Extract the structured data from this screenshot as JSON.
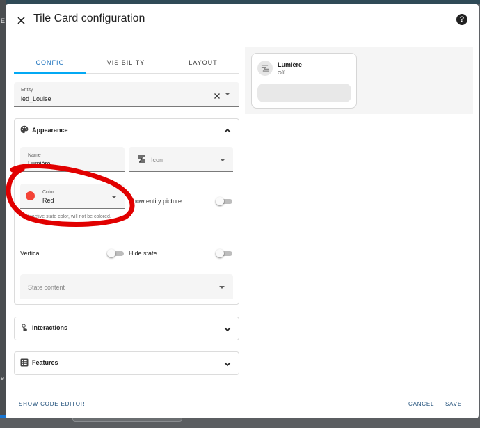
{
  "dialog": {
    "title": "Tile Card configuration",
    "help_glyph": "?"
  },
  "backdrop": {
    "left_char_top": "E",
    "left_char_bottom": "e"
  },
  "tabs": [
    {
      "label": "CONFIG",
      "active": true
    },
    {
      "label": "VISIBILITY",
      "active": false
    },
    {
      "label": "LAYOUT",
      "active": false
    }
  ],
  "entity": {
    "label": "Entity",
    "value": "led_Louise"
  },
  "appearance": {
    "title": "Appearance",
    "expanded": true,
    "name": {
      "label": "Name",
      "value": "Lumière"
    },
    "icon": {
      "placeholder": "Icon"
    },
    "color": {
      "label": "Color",
      "value": "Red",
      "swatch": "#f44336"
    },
    "color_helper": "Inactive state color, will not be colored.",
    "show_entity_picture": {
      "label": "Show entity picture",
      "on": false
    },
    "vertical": {
      "label": "Vertical",
      "on": false
    },
    "hide_state": {
      "label": "Hide state",
      "on": false
    },
    "state_content": {
      "placeholder": "State content"
    }
  },
  "interactions": {
    "title": "Interactions",
    "expanded": false
  },
  "features": {
    "title": "Features",
    "expanded": false
  },
  "preview": {
    "name": "Lumière",
    "state": "Off"
  },
  "footer": {
    "code_editor": "SHOW CODE EDITOR",
    "cancel": "CANCEL",
    "save": "SAVE"
  },
  "colors": {
    "accent": "#03a9f4",
    "annotation": "#e10000",
    "color_swatch": "#f44336"
  }
}
